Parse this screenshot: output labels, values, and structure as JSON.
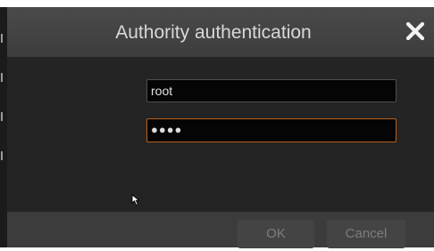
{
  "dialog": {
    "title": "Authority authentication",
    "close_icon": "close-icon",
    "username": {
      "value": "root"
    },
    "password": {
      "masked_value": "●●●●"
    },
    "ok_label": "OK",
    "cancel_label": "Cancel"
  },
  "colors": {
    "dialog_body": "#242424",
    "title_bar": "#444444",
    "title_text": "#d8d8d8",
    "field_background": "#050505",
    "focused_field_border": "#b9601f",
    "button_disabled_text": "#7d7d7d"
  },
  "pointer": "mouse-cursor-icon"
}
